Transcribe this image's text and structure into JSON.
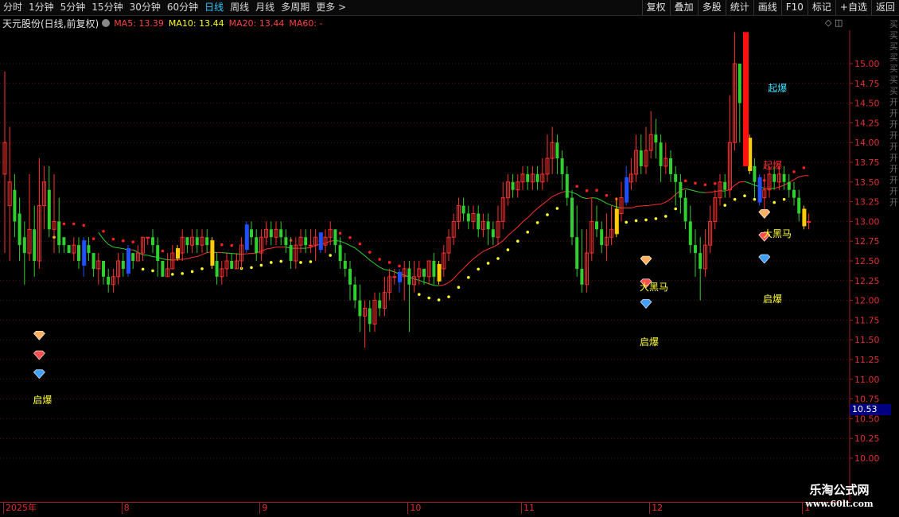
{
  "toolbar": {
    "periods": [
      "分时",
      "1分钟",
      "5分钟",
      "15分钟",
      "30分钟",
      "60分钟",
      "日线",
      "周线",
      "月线",
      "多周期",
      "更多 >"
    ],
    "active_period": "日线",
    "right_buttons": [
      "复权",
      "叠加",
      "多股",
      "统计",
      "画线",
      "F10",
      "标记",
      "+自选",
      "返回"
    ]
  },
  "info": {
    "stock_title": "天元股份(日线,前复权)",
    "ma5": "MA5: 13.39",
    "ma10": "MA10: 13.44",
    "ma20": "MA20: 13.44",
    "ma60": "MA60: -",
    "colors": {
      "ma5": "#ff4040",
      "ma10": "#ffff00",
      "ma20": "#ff4040",
      "ma60": "#ff4040"
    }
  },
  "side_chars": [
    "买",
    "买",
    "买",
    "买",
    "买",
    "买",
    "买",
    "开",
    "开",
    "开",
    "开",
    "开",
    "开",
    "开",
    "开",
    "开",
    "开"
  ],
  "current_price": "10.53",
  "price_axis": {
    "min": 9.75,
    "max": 15.4,
    "ticks": [
      "15.00",
      "14.75",
      "14.50",
      "14.25",
      "14.00",
      "13.75",
      "13.50",
      "13.25",
      "13.00",
      "12.75",
      "12.50",
      "12.25",
      "12.00",
      "11.75",
      "11.50",
      "11.25",
      "11.00",
      "10.75",
      "10.50",
      "10.25",
      "10.00"
    ]
  },
  "date_axis": [
    {
      "label": "2025年",
      "bar": 0
    },
    {
      "label": "8",
      "bar": 24
    },
    {
      "label": "9",
      "bar": 52
    },
    {
      "label": "10",
      "bar": 82
    },
    {
      "label": "11",
      "bar": 105
    },
    {
      "label": "12",
      "bar": 131
    },
    {
      "label": "1",
      "bar": 162
    }
  ],
  "annotations": [
    {
      "text": "启爆",
      "bar": 7,
      "price": 10.75,
      "color": "#ffff40"
    },
    {
      "text": "启爆",
      "bar": 130,
      "price": 11.48,
      "color": "#ffff40"
    },
    {
      "text": "大黑马",
      "bar": 130,
      "price": 12.18,
      "color": "#ffff40"
    },
    {
      "text": "启爆",
      "bar": 155,
      "price": 12.03,
      "color": "#ffff40"
    },
    {
      "text": "大黑马",
      "bar": 155,
      "price": 12.85,
      "color": "#ffff40"
    },
    {
      "text": "起爆",
      "bar": 156,
      "price": 14.7,
      "color": "#40e0ff"
    },
    {
      "text": "起爆",
      "bar": 155,
      "price": 13.72,
      "color": "#ff3030"
    }
  ],
  "diamond_groups": [
    {
      "bar": 7,
      "prices": [
        11.55,
        11.3,
        11.06
      ]
    },
    {
      "bar": 130,
      "prices": [
        12.5,
        12.21,
        11.95
      ]
    },
    {
      "bar": 154,
      "prices": [
        13.09,
        12.8,
        12.52
      ]
    }
  ],
  "watermark": {
    "title": "乐淘公式网",
    "url": "www.60lt.com"
  },
  "chart_data": {
    "type": "candlestick",
    "candles": [
      [
        13.6,
        14.0,
        12.6,
        14.9
      ],
      [
        13.2,
        13.5,
        12.5,
        14.2
      ],
      [
        13.4,
        13.0,
        12.8,
        13.6
      ],
      [
        13.1,
        12.7,
        12.5,
        13.3
      ],
      [
        12.8,
        12.6,
        12.2,
        13.0
      ],
      [
        12.6,
        12.9,
        12.5,
        13.6
      ],
      [
        12.9,
        12.5,
        12.3,
        13.2
      ],
      [
        12.5,
        13.2,
        12.4,
        13.8
      ],
      [
        13.2,
        13.5,
        12.9,
        13.7
      ],
      [
        13.4,
        12.9,
        12.8,
        13.7
      ],
      [
        12.9,
        13.0,
        12.6,
        13.6
      ],
      [
        13.0,
        12.7,
        12.6,
        13.3
      ],
      [
        12.8,
        12.7,
        12.6,
        12.8
      ],
      [
        12.7,
        12.6,
        12.6,
        12.7
      ],
      [
        12.6,
        12.7,
        12.5,
        12.8
      ],
      [
        12.7,
        12.5,
        12.4,
        12.8
      ],
      [
        12.5,
        12.7,
        12.3,
        12.8
      ],
      [
        12.7,
        12.6,
        12.5,
        12.8
      ],
      [
        12.6,
        12.4,
        12.3,
        12.6
      ],
      [
        12.4,
        12.5,
        12.2,
        12.6
      ],
      [
        12.5,
        12.3,
        12.2,
        12.5
      ],
      [
        12.3,
        12.2,
        12.1,
        12.4
      ],
      [
        12.2,
        12.3,
        12.1,
        12.4
      ],
      [
        12.3,
        12.5,
        12.2,
        12.6
      ],
      [
        12.5,
        12.4,
        12.3,
        12.6
      ],
      [
        12.4,
        12.6,
        12.3,
        12.7
      ],
      [
        12.6,
        12.5,
        12.4,
        12.6
      ],
      [
        12.5,
        12.6,
        12.5,
        12.7
      ],
      [
        12.6,
        12.8,
        12.5,
        12.8
      ],
      [
        12.8,
        12.8,
        12.7,
        12.8
      ],
      [
        12.8,
        12.7,
        12.6,
        12.9
      ],
      [
        12.7,
        12.5,
        12.3,
        12.8
      ],
      [
        12.5,
        12.3,
        12.3,
        12.5
      ],
      [
        12.3,
        12.4,
        12.3,
        12.6
      ],
      [
        12.4,
        12.6,
        12.4,
        12.7
      ],
      [
        12.6,
        12.6,
        12.5,
        12.7
      ],
      [
        12.6,
        12.8,
        12.5,
        12.9
      ],
      [
        12.8,
        12.7,
        12.6,
        12.8
      ],
      [
        12.7,
        12.8,
        12.6,
        12.9
      ],
      [
        12.8,
        12.7,
        12.6,
        12.9
      ],
      [
        12.7,
        12.8,
        12.6,
        12.9
      ],
      [
        12.8,
        12.7,
        12.6,
        12.9
      ],
      [
        12.7,
        12.5,
        12.4,
        12.8
      ],
      [
        12.5,
        12.3,
        12.2,
        12.6
      ],
      [
        12.3,
        12.4,
        12.2,
        12.5
      ],
      [
        12.4,
        12.5,
        12.3,
        12.6
      ],
      [
        12.5,
        12.4,
        12.4,
        12.6
      ],
      [
        12.4,
        12.5,
        12.4,
        12.6
      ],
      [
        12.5,
        12.7,
        12.4,
        12.8
      ],
      [
        12.7,
        12.9,
        12.6,
        13.0
      ],
      [
        12.9,
        12.8,
        12.7,
        13.0
      ],
      [
        12.8,
        12.6,
        12.5,
        12.9
      ],
      [
        12.6,
        12.8,
        12.5,
        12.9
      ],
      [
        12.8,
        12.9,
        12.7,
        13.0
      ],
      [
        12.9,
        12.8,
        12.7,
        13.0
      ],
      [
        12.8,
        12.9,
        12.7,
        13.0
      ],
      [
        12.9,
        12.8,
        12.7,
        13.0
      ],
      [
        12.8,
        12.7,
        12.6,
        12.9
      ],
      [
        12.7,
        12.5,
        12.4,
        12.8
      ],
      [
        12.5,
        12.7,
        12.4,
        12.8
      ],
      [
        12.7,
        12.8,
        12.6,
        12.9
      ],
      [
        12.8,
        12.7,
        12.6,
        12.9
      ],
      [
        12.7,
        12.7,
        12.6,
        12.9
      ],
      [
        12.7,
        12.8,
        12.5,
        12.9
      ],
      [
        12.8,
        12.7,
        12.6,
        12.8
      ],
      [
        12.7,
        12.8,
        12.6,
        12.9
      ],
      [
        12.8,
        12.9,
        12.7,
        13.0
      ],
      [
        12.9,
        12.7,
        12.6,
        12.9
      ],
      [
        12.7,
        12.5,
        12.4,
        12.8
      ],
      [
        12.5,
        12.4,
        12.3,
        12.6
      ],
      [
        12.4,
        12.2,
        12.0,
        12.5
      ],
      [
        12.2,
        12.0,
        11.9,
        12.3
      ],
      [
        12.0,
        11.8,
        11.6,
        12.2
      ],
      [
        11.8,
        11.9,
        11.4,
        12.0
      ],
      [
        11.9,
        11.7,
        11.6,
        12.0
      ],
      [
        11.7,
        12.0,
        11.6,
        12.1
      ],
      [
        12.0,
        11.9,
        11.8,
        12.1
      ],
      [
        11.9,
        12.1,
        11.8,
        12.3
      ],
      [
        12.1,
        12.3,
        12.0,
        12.4
      ],
      [
        12.3,
        12.3,
        12.2,
        12.4
      ],
      [
        12.3,
        12.3,
        12.1,
        12.4
      ],
      [
        12.3,
        12.4,
        12.0,
        12.5
      ],
      [
        12.4,
        12.2,
        11.6,
        12.5
      ],
      [
        12.2,
        12.3,
        12.1,
        12.5
      ],
      [
        12.3,
        12.4,
        12.2,
        12.5
      ],
      [
        12.4,
        12.3,
        12.2,
        12.4
      ],
      [
        12.3,
        12.5,
        12.2,
        12.5
      ],
      [
        12.5,
        12.3,
        12.2,
        12.6
      ],
      [
        12.3,
        12.4,
        12.2,
        12.5
      ],
      [
        12.4,
        12.6,
        12.3,
        12.7
      ],
      [
        12.6,
        12.8,
        12.5,
        12.9
      ],
      [
        12.8,
        13.0,
        12.7,
        13.1
      ],
      [
        13.0,
        13.2,
        12.9,
        13.3
      ],
      [
        13.2,
        13.1,
        13.0,
        13.3
      ],
      [
        13.1,
        13.0,
        12.9,
        13.2
      ],
      [
        13.0,
        13.1,
        12.9,
        13.2
      ],
      [
        13.1,
        12.9,
        12.8,
        13.2
      ],
      [
        12.9,
        13.0,
        12.8,
        13.1
      ],
      [
        13.0,
        12.9,
        12.7,
        13.1
      ],
      [
        12.9,
        12.8,
        12.7,
        13.0
      ],
      [
        12.8,
        13.0,
        12.7,
        13.2
      ],
      [
        13.0,
        13.3,
        12.9,
        13.5
      ],
      [
        13.3,
        13.5,
        13.2,
        13.6
      ],
      [
        13.5,
        13.4,
        13.3,
        13.6
      ],
      [
        13.4,
        13.5,
        13.3,
        13.6
      ],
      [
        13.5,
        13.6,
        13.4,
        13.7
      ],
      [
        13.6,
        13.5,
        13.4,
        13.7
      ],
      [
        13.5,
        13.6,
        13.4,
        13.7
      ],
      [
        13.6,
        13.5,
        13.4,
        13.7
      ],
      [
        13.5,
        13.6,
        13.4,
        13.8
      ],
      [
        13.6,
        13.8,
        13.5,
        14.1
      ],
      [
        13.8,
        14.0,
        13.6,
        14.2
      ],
      [
        14.0,
        13.8,
        13.6,
        14.1
      ],
      [
        13.8,
        13.6,
        13.4,
        13.9
      ],
      [
        13.6,
        13.3,
        13.2,
        13.7
      ],
      [
        13.3,
        12.8,
        12.7,
        13.4
      ],
      [
        12.8,
        12.4,
        12.3,
        13.2
      ],
      [
        12.4,
        12.2,
        12.1,
        12.9
      ],
      [
        12.2,
        12.6,
        12.1,
        12.9
      ],
      [
        12.6,
        13.0,
        12.5,
        13.3
      ],
      [
        13.0,
        12.9,
        12.8,
        13.2
      ],
      [
        12.9,
        12.7,
        12.6,
        13.0
      ],
      [
        12.7,
        12.8,
        12.5,
        13.1
      ],
      [
        12.8,
        12.9,
        12.7,
        13.2
      ],
      [
        12.9,
        13.1,
        12.8,
        13.3
      ],
      [
        13.1,
        13.3,
        13.0,
        13.5
      ],
      [
        13.3,
        13.5,
        13.2,
        13.7
      ],
      [
        13.5,
        13.6,
        13.4,
        13.8
      ],
      [
        13.6,
        13.9,
        13.5,
        14.1
      ],
      [
        13.9,
        13.7,
        13.6,
        14.1
      ],
      [
        13.7,
        13.9,
        13.6,
        14.2
      ],
      [
        13.9,
        14.1,
        13.8,
        14.4
      ],
      [
        14.1,
        14.0,
        13.8,
        14.3
      ],
      [
        14.0,
        13.7,
        13.5,
        14.1
      ],
      [
        13.7,
        13.8,
        13.6,
        14.0
      ],
      [
        13.8,
        13.6,
        13.5,
        13.9
      ],
      [
        13.6,
        13.5,
        13.2,
        13.7
      ],
      [
        13.5,
        13.3,
        13.1,
        13.6
      ],
      [
        13.3,
        13.0,
        12.9,
        13.4
      ],
      [
        13.0,
        12.7,
        12.6,
        13.2
      ],
      [
        12.7,
        12.6,
        12.3,
        12.9
      ],
      [
        12.6,
        12.4,
        12.0,
        12.8
      ],
      [
        12.4,
        12.7,
        12.3,
        12.9
      ],
      [
        12.7,
        13.0,
        12.6,
        13.2
      ],
      [
        13.0,
        13.3,
        12.9,
        13.4
      ],
      [
        13.3,
        13.5,
        13.2,
        13.6
      ],
      [
        13.5,
        13.4,
        13.3,
        13.6
      ],
      [
        13.4,
        14.0,
        13.3,
        14.6
      ],
      [
        14.0,
        15.0,
        13.9,
        15.4
      ],
      [
        15.0,
        14.5,
        14.0,
        14.8
      ],
      [
        14.5,
        14.0,
        13.8,
        14.6
      ],
      [
        14.0,
        13.7,
        13.6,
        14.1
      ],
      [
        13.7,
        13.5,
        13.3,
        13.8
      ],
      [
        13.5,
        13.3,
        13.2,
        13.6
      ],
      [
        13.3,
        13.4,
        13.1,
        13.6
      ],
      [
        13.4,
        13.6,
        13.3,
        13.7
      ],
      [
        13.6,
        13.5,
        13.4,
        13.7
      ],
      [
        13.5,
        13.6,
        13.4,
        13.7
      ],
      [
        13.6,
        13.5,
        13.4,
        13.7
      ],
      [
        13.5,
        13.4,
        13.3,
        13.6
      ],
      [
        13.4,
        13.3,
        13.2,
        13.5
      ],
      [
        13.3,
        13.1,
        13.0,
        13.4
      ],
      [
        13.1,
        13.0,
        12.9,
        13.2
      ],
      [
        13.0,
        13.0,
        12.9,
        13.1
      ]
    ],
    "special_bars": {
      "blue": [
        16,
        25,
        49,
        64,
        80,
        126,
        153,
        166
      ],
      "yellow": [
        35,
        42,
        88,
        124,
        151,
        162
      ]
    }
  }
}
